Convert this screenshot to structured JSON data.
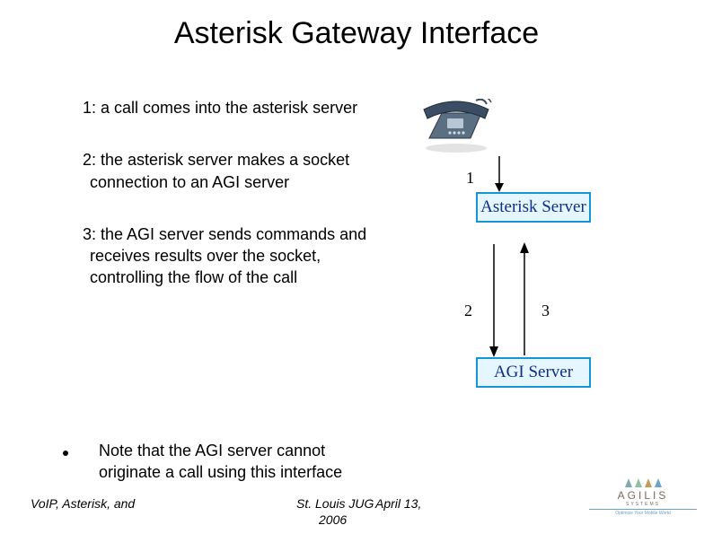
{
  "title": "Asterisk Gateway Interface",
  "steps": {
    "s1": "1: a call comes into the asterisk server",
    "s2": "2: the asterisk server makes a socket connection to an AGI server",
    "s3": "3: the AGI server sends commands and receives results over the socket, controlling the flow of the call"
  },
  "note": "Note that the AGI server cannot originate a call using this interface",
  "footer": {
    "left": "VoIP, Asterisk, and",
    "center": "St. Louis JUG",
    "date": "April 13,",
    "center2": "2006"
  },
  "diagram": {
    "box1": "Asterisk Server",
    "box2": "AGI Server",
    "label1": "1",
    "label2": "2",
    "label3": "3"
  },
  "logo": {
    "name": "AGILIS",
    "systems": "SYSTEMS",
    "tag": "Optimize Your Mobile World"
  }
}
